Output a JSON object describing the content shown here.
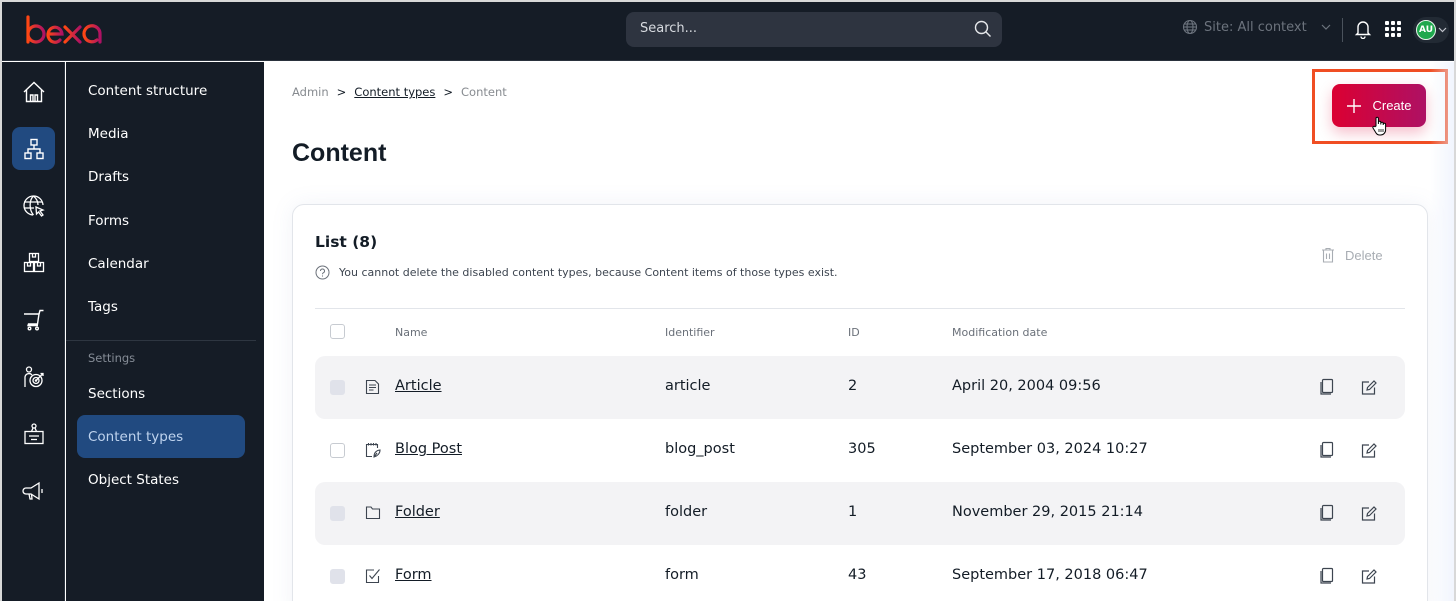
{
  "brand": {
    "logo_text": "ibexa",
    "accent_start": "#ff4713",
    "accent_end": "#ae1164"
  },
  "topbar": {
    "search_placeholder": "Search...",
    "site_context_label": "Site: All context",
    "avatar_initials": "AU",
    "icons": [
      "search-icon",
      "globe-icon",
      "chevron-down-icon",
      "bell-icon",
      "apps-grid-icon"
    ]
  },
  "rail": {
    "items": [
      {
        "icon": "home-icon",
        "active": false
      },
      {
        "icon": "content-tree-icon",
        "active": true
      },
      {
        "icon": "globe-cursor-icon",
        "active": false
      },
      {
        "icon": "boxes-icon",
        "active": false
      },
      {
        "icon": "cart-icon",
        "active": false
      },
      {
        "icon": "person-target-icon",
        "active": false
      },
      {
        "icon": "badge-icon",
        "active": false
      },
      {
        "icon": "megaphone-icon",
        "active": false
      }
    ]
  },
  "subnav": {
    "items": [
      {
        "label": "Content structure"
      },
      {
        "label": "Media"
      },
      {
        "label": "Drafts"
      },
      {
        "label": "Forms"
      },
      {
        "label": "Calendar"
      },
      {
        "label": "Tags"
      }
    ],
    "settings_group_label": "Settings",
    "settings_items": [
      {
        "label": "Sections",
        "active": false
      },
      {
        "label": "Content types",
        "active": true
      },
      {
        "label": "Object States",
        "active": false
      }
    ]
  },
  "breadcrumb": {
    "items": [
      "Admin",
      "Content types",
      "Content"
    ],
    "separator": ">"
  },
  "page": {
    "title": "Content",
    "create_label": "Create"
  },
  "list": {
    "title": "List (8)",
    "hint": "You cannot delete the disabled content types, because Content items of those types exist.",
    "delete_label": "Delete",
    "columns": [
      "Name",
      "Identifier",
      "ID",
      "Modification date"
    ],
    "rows": [
      {
        "name": "Article",
        "identifier": "article",
        "id": "2",
        "modified": "April 20, 2004 09:56",
        "icon": "article-icon",
        "selectable": false
      },
      {
        "name": "Blog Post",
        "identifier": "blog_post",
        "id": "305",
        "modified": "September 03, 2024 10:27",
        "icon": "blog-post-icon",
        "selectable": true
      },
      {
        "name": "Folder",
        "identifier": "folder",
        "id": "1",
        "modified": "November 29, 2015 21:14",
        "icon": "folder-icon",
        "selectable": false
      },
      {
        "name": "Form",
        "identifier": "form",
        "id": "43",
        "modified": "September 17, 2018 06:47",
        "icon": "form-icon",
        "selectable": false
      }
    ]
  }
}
